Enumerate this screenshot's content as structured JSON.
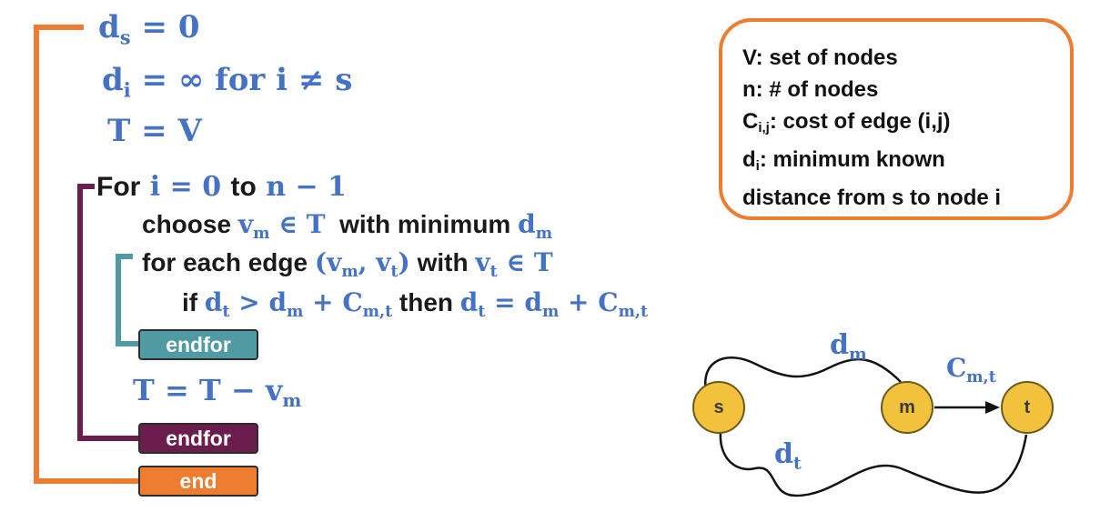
{
  "algorithm": {
    "init": {
      "ds_var": "d",
      "ds_sub": "s",
      "ds_rest": " = 0",
      "di_var": "d",
      "di_sub": "i",
      "di_eq": " = ∞ ",
      "di_for": "for",
      "di_cond": " i ≠ s",
      "t_eq": "T = V"
    },
    "loop": {
      "for_kw": "For",
      "for_range_a": " i = 0 ",
      "to_kw": "to",
      "for_range_b": " n − 1",
      "choose_kw": "choose",
      "choose_v": "v",
      "choose_vsub": "m",
      "choose_in": " ∈ T",
      "with_min_kw": "with minimum",
      "choose_d": "d",
      "choose_dsub": "m",
      "foreach_kw": "for each edge",
      "edge_open": "(v",
      "edge_m": "m",
      "edge_comma": ", v",
      "edge_t": "t",
      "edge_close": ")",
      "with_kw": "with",
      "vt_v": "v",
      "vt_sub": "t",
      "vt_in": " ∈ T",
      "if_kw": "if",
      "if_dt": "d",
      "if_dt_sub": "t",
      "if_gt": " > d",
      "if_dm_sub": "m",
      "if_plus": " + C",
      "if_c_sub": "m,t",
      "then_kw": "then",
      "then_dt": "d",
      "then_dt_sub": "t",
      "then_eq": " = d",
      "then_dm_sub": "m",
      "then_plus": " + C",
      "then_c_sub": "m,t",
      "update_t": "T = T − v",
      "update_sub": "m"
    },
    "badges": {
      "inner_endfor": "endfor",
      "outer_endfor": "endfor",
      "end": "end"
    }
  },
  "legend": {
    "line1": "V: set of nodes",
    "line2": "n: # of nodes",
    "line3_a": "C",
    "line3_sub": "i,j",
    "line3_b": ": cost of edge (i,j)",
    "line4_a": "d",
    "line4_sub": "i",
    "line4_b": ": minimum known",
    "line5": "distance from s to node i"
  },
  "graph": {
    "nodes": {
      "s": "s",
      "m": "m",
      "t": "t"
    },
    "labels": {
      "dm": "d",
      "dm_sub": "m",
      "cmt": "C",
      "cmt_sub": "m,t",
      "dt": "d",
      "dt_sub": "t"
    }
  },
  "colors": {
    "orange": "#ed7d31",
    "purple": "#6b1d4e",
    "teal": "#4f9aa3",
    "blue_math": "#4472c4",
    "node_fill": "#f2c23d"
  }
}
